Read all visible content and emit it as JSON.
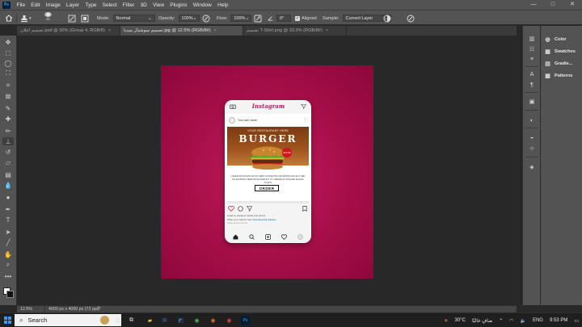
{
  "menu": {
    "logo": "Ps",
    "items": [
      "File",
      "Edit",
      "Image",
      "Layer",
      "Type",
      "Select",
      "Filter",
      "3D",
      "View",
      "Plugins",
      "Window",
      "Help"
    ],
    "window_controls": [
      "—",
      "□",
      "✕"
    ]
  },
  "options": {
    "brush_size": "21",
    "mode_label": "Mode:",
    "mode_value": "Normal",
    "opacity_label": "Opacity:",
    "opacity_value": "100%",
    "flow_label": "Flow:",
    "flow_value": "100%",
    "angle_value": "0°",
    "aligned_label": "Aligned",
    "sample_label": "Sample:",
    "sample_value": "Current Layer"
  },
  "tabs": [
    {
      "label": "تصميم اعلان.psd @ 50% (Group 4, RGB/8)",
      "active": false
    },
    {
      "label": "تصميم سوشيال ميديا.jpg @ 12.5% (RGB/8#)",
      "active": true
    },
    {
      "label": "تصميم T-Shirt.png @ 33.3% (RGB/8#)",
      "active": false
    }
  ],
  "tools": [
    "move-tool",
    "artboard-tool",
    "lasso-tool",
    "object-select-tool",
    "crop-tool",
    "frame-tool",
    "eyedropper-tool",
    "healing-tool",
    "brush-tool",
    "clone-stamp-tool",
    "history-brush-tool",
    "eraser-tool",
    "gradient-tool",
    "blur-tool",
    "dodge-tool",
    "pen-tool",
    "type-tool",
    "path-select-tool",
    "line-tool",
    "hand-tool",
    "zoom-tool",
    "more-tools"
  ],
  "active_tool": "clone-stamp-tool",
  "panels": [
    {
      "icon": "color-icon",
      "label": "Color"
    },
    {
      "icon": "swatches-icon",
      "label": "Swatches"
    },
    {
      "icon": "gradients-icon",
      "label": "Gradie..."
    },
    {
      "icon": "patterns-icon",
      "label": "Patterns"
    }
  ],
  "post": {
    "app_name": "Instagram",
    "username": "Your user name",
    "tagline": "YOUR RESTAURANT HERE",
    "headline": "BURGER",
    "price_badge": "$14.99",
    "description": "LOREM IPSUM DOLOR SIT AMET CONSECTETUR ADIPISCING ELIT SED DO EIUSMOD TEMPOR INCIDIDUNT UT LABORE ET DOLORE MAGNA ALIQUA",
    "cta": "ORDER",
    "likes_line": "Liked by designer.studio and others",
    "caption_line": "Write your caption here",
    "hashtags": "#socialmedia #design",
    "comments_line": "View all comments"
  },
  "status": {
    "zoom": "12.5%",
    "doc_size": "4000 px x 4000 px (72 ppi)",
    "chevron": ">"
  },
  "taskbar": {
    "search_text": "Search",
    "weather": "30°C",
    "weather_desc": "صافٍ غالبًا",
    "language": "ENG",
    "time": "9:53 PM"
  },
  "colors": {
    "canvas_bg": "#a50e48",
    "ps_chrome": "#535353",
    "accent_instagram": "#c2185b"
  }
}
